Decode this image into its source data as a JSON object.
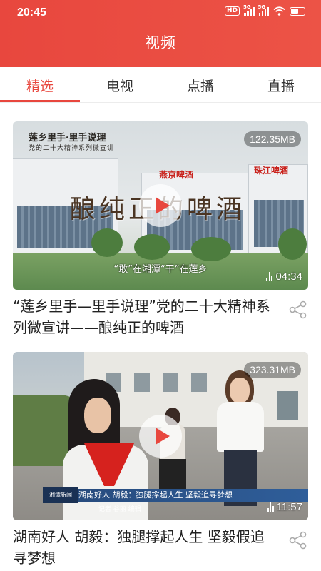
{
  "status_bar": {
    "time": "20:45",
    "hd_badge": "HD",
    "signal1_label": "5G",
    "signal2_label": "5G"
  },
  "header": {
    "title": "视频",
    "color": "#e8473e"
  },
  "tabs": [
    {
      "label": "精选",
      "active": true
    },
    {
      "label": "电视",
      "active": false
    },
    {
      "label": "点播",
      "active": false
    },
    {
      "label": "直播",
      "active": false
    }
  ],
  "videos": [
    {
      "size": "122.35MB",
      "duration": "04:34",
      "title": "“莲乡里手—里手说理”党的二十大精神系列微宣讲——酿纯正的啤酒",
      "thumbnail": {
        "overlay_title": "酿纯正的啤酒",
        "logo_line1": "莲乡里手·里手说理",
        "logo_line2": "党的二十大精神系列微宣讲",
        "subtitle": "“敢”在湘潭“干”在莲乡",
        "sign_left": "燕京啤酒",
        "sign_right": "珠江啤酒"
      }
    },
    {
      "size": "323.31MB",
      "duration": "11:57",
      "title": "湖南好人 胡毅：独腿撑起人生 坚毅假追寻梦想",
      "thumbnail": {
        "news_logo": "湘潭新闻",
        "news_bar": "湖南好人  胡毅：独腿撑起人生 坚毅追寻梦想",
        "credits": "记者  谷丽  编辑"
      }
    }
  ]
}
